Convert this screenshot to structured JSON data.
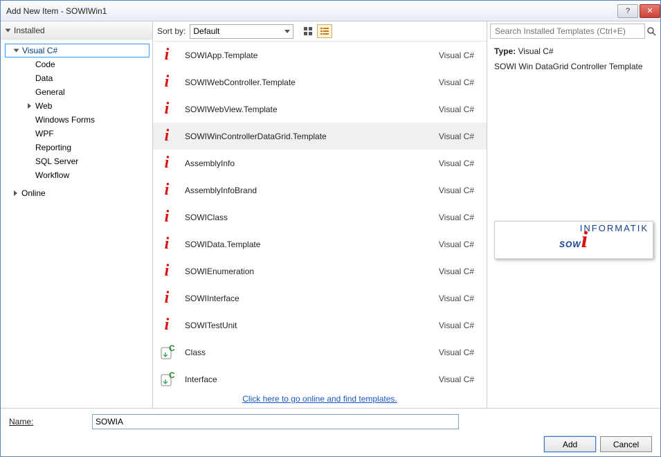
{
  "window_title": "Add New Item - SOWIWin1",
  "sidebar_header": "Installed",
  "tree": {
    "root": "Visual C#",
    "children": [
      "Code",
      "Data",
      "General",
      "Web",
      "Windows Forms",
      "WPF",
      "Reporting",
      "SQL Server",
      "Workflow"
    ],
    "web_expandable": true,
    "online": "Online"
  },
  "toolbar": {
    "sort_label": "Sort by:",
    "sort_value": "Default"
  },
  "templates": [
    {
      "name": "SOWIApp.Template",
      "lang": "Visual C#",
      "icon": "swirl"
    },
    {
      "name": "SOWIWebController.Template",
      "lang": "Visual C#",
      "icon": "swirl"
    },
    {
      "name": "SOWIWebView.Template",
      "lang": "Visual C#",
      "icon": "swirl"
    },
    {
      "name": "SOWIWinControllerDataGrid.Template",
      "lang": "Visual C#",
      "icon": "swirl",
      "selected": true
    },
    {
      "name": "AssemblyInfo",
      "lang": "Visual C#",
      "icon": "swirl"
    },
    {
      "name": "AssemblyInfoBrand",
      "lang": "Visual C#",
      "icon": "swirl"
    },
    {
      "name": "SOWIClass",
      "lang": "Visual C#",
      "icon": "swirl"
    },
    {
      "name": "SOWIData.Template",
      "lang": "Visual C#",
      "icon": "swirl"
    },
    {
      "name": "SOWIEnumeration",
      "lang": "Visual C#",
      "icon": "swirl"
    },
    {
      "name": "SOWIInterface",
      "lang": "Visual C#",
      "icon": "swirl"
    },
    {
      "name": "SOWITestUnit",
      "lang": "Visual C#",
      "icon": "swirl"
    },
    {
      "name": "Class",
      "lang": "Visual C#",
      "icon": "cs"
    },
    {
      "name": "Interface",
      "lang": "Visual C#",
      "icon": "cs"
    }
  ],
  "online_link": "Click here to go online and find templates.",
  "search": {
    "placeholder": "Search Installed Templates (Ctrl+E)"
  },
  "details": {
    "type_label": "Type:",
    "type_value": "Visual C#",
    "description": "SOWI Win DataGrid Controller Template"
  },
  "logo": {
    "brand": "SOW",
    "tag": "INFORMATIK"
  },
  "bottom": {
    "name_label": "Name:",
    "name_value": "SOWIA",
    "add": "Add",
    "cancel": "Cancel"
  }
}
